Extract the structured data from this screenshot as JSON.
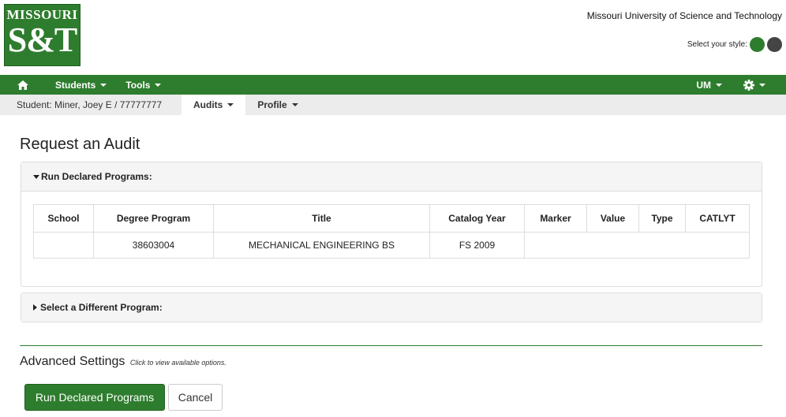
{
  "header": {
    "logo_line1": "MISSOURI",
    "logo_line2": "S&T",
    "university": "Missouri University of Science and Technology",
    "style_label": "Select your style:",
    "style_colors": [
      "#2e7d2e",
      "#444444"
    ]
  },
  "nav": {
    "home_icon": "home-icon",
    "items": [
      {
        "label": "Students"
      },
      {
        "label": "Tools"
      }
    ],
    "right": {
      "campus": "UM",
      "settings_icon": "gear-icon"
    }
  },
  "subnav": {
    "student": "Student: Miner, Joey E / 77777777",
    "tabs": [
      {
        "label": "Audits"
      },
      {
        "label": "Profile"
      }
    ]
  },
  "main": {
    "title": "Request an Audit",
    "declared_panel": {
      "heading": "Run Declared Programs:",
      "columns": [
        "School",
        "Degree Program",
        "Title",
        "Catalog Year",
        "Marker",
        "Value",
        "Type",
        "CATLYT"
      ],
      "rows": [
        {
          "school": "",
          "degree_program": "38603004",
          "title": "MECHANICAL ENGINEERING BS",
          "catalog_year": "FS 2009"
        }
      ]
    },
    "different_panel": {
      "heading": "Select a Different Program:"
    },
    "advanced": {
      "title": "Advanced Settings",
      "hint": "Click to view available options."
    },
    "buttons": {
      "run": "Run Declared Programs",
      "cancel": "Cancel"
    }
  },
  "colors": {
    "brand_green": "#2e7d2e"
  }
}
